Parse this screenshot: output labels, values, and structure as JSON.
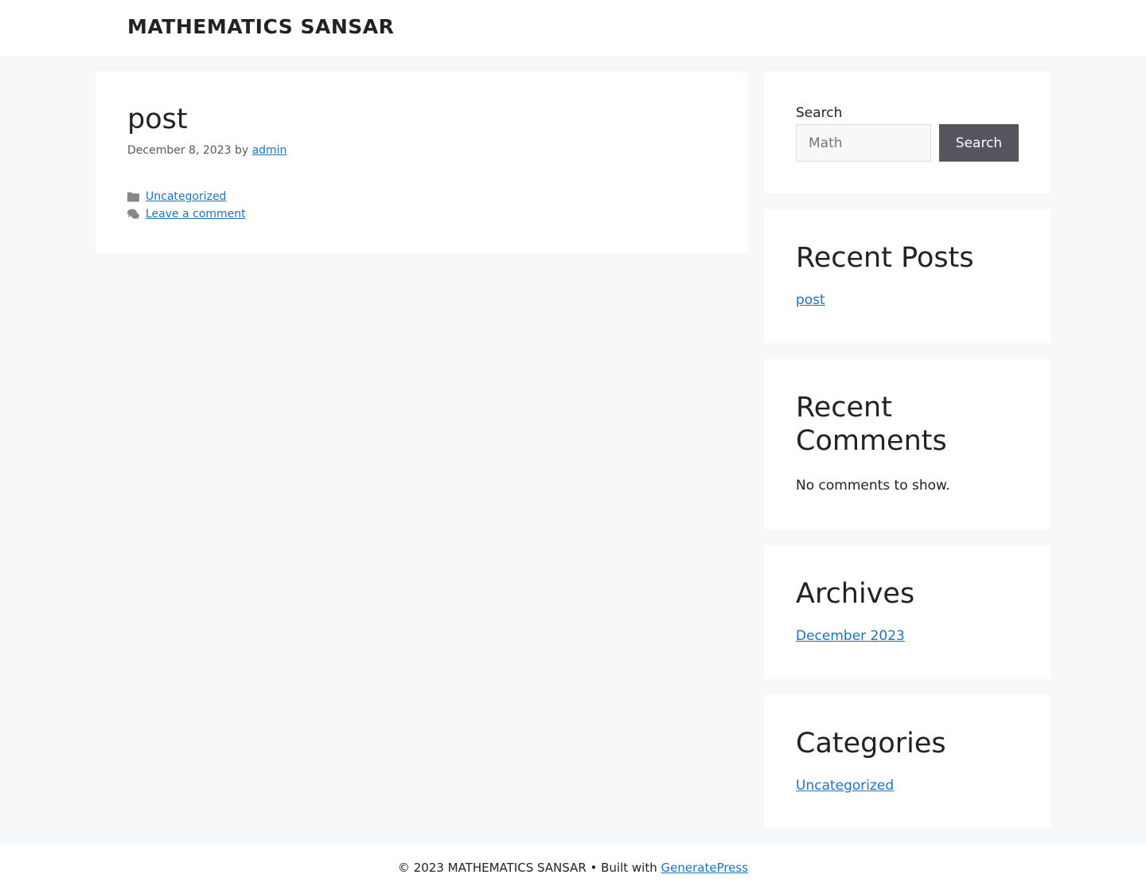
{
  "header": {
    "site_title": "MATHEMATICS SANSAR"
  },
  "article": {
    "title": "post",
    "date": "December 8, 2023",
    "by": "by",
    "author": "admin",
    "category": "Uncategorized",
    "comment_link": "Leave a comment",
    "icons": [
      "folder-icon",
      "comments-icon"
    ]
  },
  "sidebar": {
    "search": {
      "label": "Search",
      "placeholder": "Math",
      "button_label": "Search"
    },
    "recent_posts": {
      "title": "Recent Posts",
      "items": [
        "post"
      ]
    },
    "recent_comments": {
      "title_line1": "Recent",
      "title_line2": "Comments",
      "empty_text": "No comments to show."
    },
    "archives": {
      "title": "Archives",
      "items": [
        "December 2023"
      ]
    },
    "categories": {
      "title": "Categories",
      "items": [
        "Uncategorized"
      ]
    }
  },
  "footer": {
    "copyright": "© 2023 MATHEMATICS SANSAR • Built with ",
    "builder_link": "GeneratePress"
  },
  "colors": {
    "background": "#f7f8f9",
    "link": "#1e73be",
    "button": "#55555e",
    "text": "#222222"
  }
}
